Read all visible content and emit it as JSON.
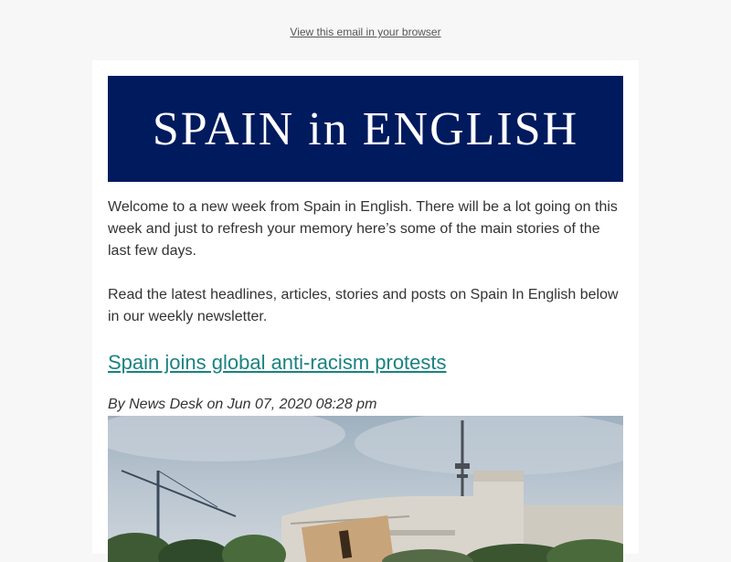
{
  "preheader": {
    "link_text": "View this email in your browser"
  },
  "banner": {
    "title": "SPAIN in ENGLISH",
    "background_color": "#001a5e"
  },
  "intro": {
    "paragraph1": "Welcome to a new week from Spain in English. There will be a lot going on this week and just to refresh your memory here’s some of the main stories of the last few days.",
    "paragraph2": "Read the latest headlines, articles, stories and posts on Spain In English below in our weekly newsletter."
  },
  "article": {
    "headline": "Spain joins global anti-racism protests",
    "byline": "By News Desk on Jun 07, 2020 08:28 pm",
    "link_color": "#1a8282"
  }
}
